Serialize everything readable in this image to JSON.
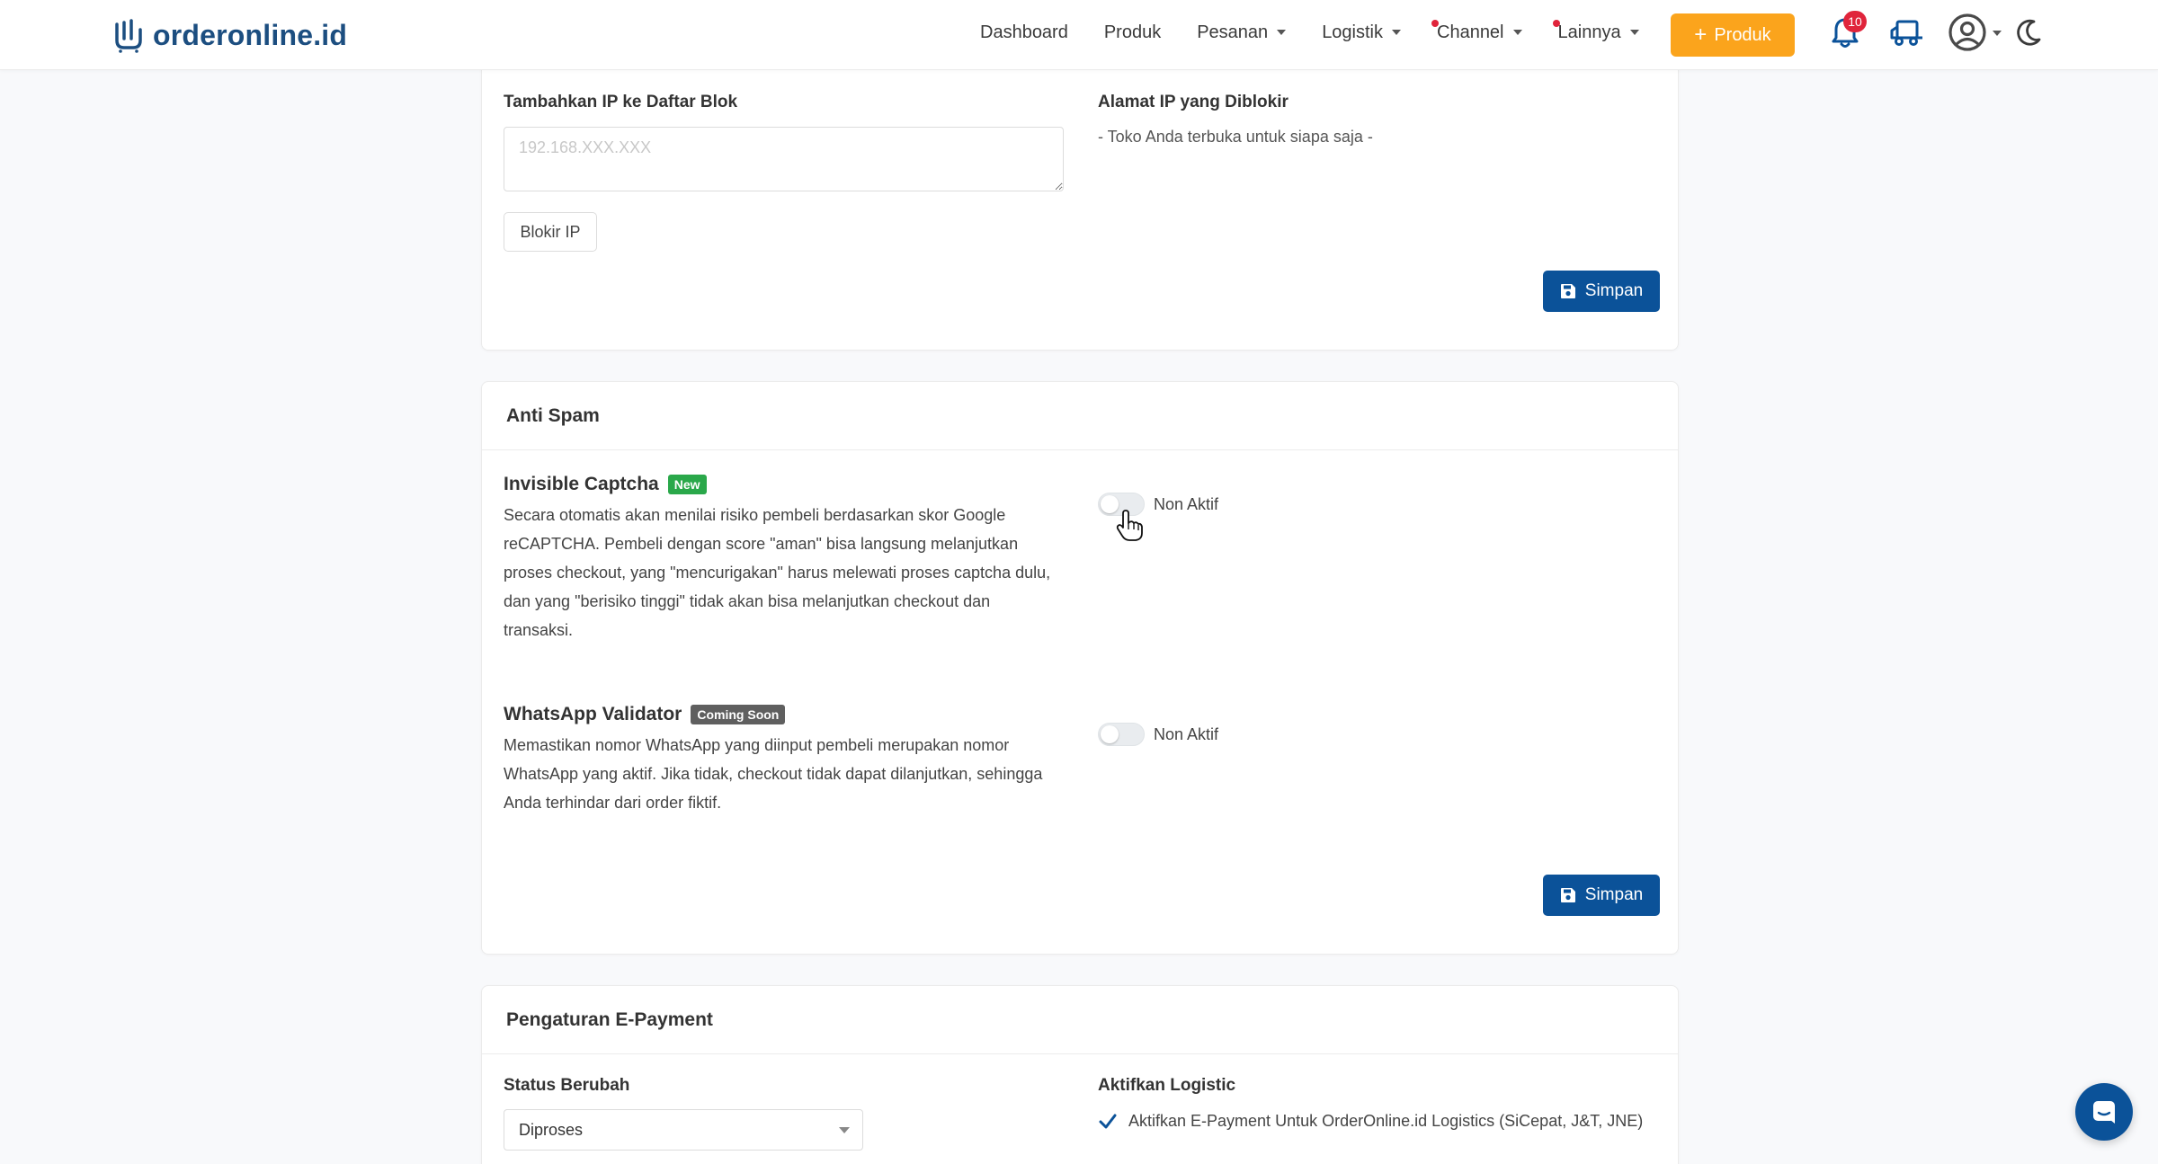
{
  "brand": {
    "name": "orderonline.id"
  },
  "nav": {
    "items": [
      {
        "label": "Dashboard",
        "has_dropdown": false,
        "has_dot": false
      },
      {
        "label": "Produk",
        "has_dropdown": false,
        "has_dot": false
      },
      {
        "label": "Pesanan",
        "has_dropdown": true,
        "has_dot": false
      },
      {
        "label": "Logistik",
        "has_dropdown": true,
        "has_dot": false
      },
      {
        "label": "Channel",
        "has_dropdown": true,
        "has_dot": true
      },
      {
        "label": "Lainnya",
        "has_dropdown": true,
        "has_dot": true
      }
    ],
    "add_product_label": "Produk",
    "notification_count": "10",
    "icons": [
      "bell-icon",
      "truck-icon",
      "user-icon",
      "moon-icon"
    ]
  },
  "ip_block": {
    "add_label": "Tambahkan IP ke Daftar Blok",
    "placeholder": "192.168.XXX.XXX",
    "block_button": "Blokir IP",
    "blocked_label": "Alamat IP yang Diblokir",
    "blocked_empty": "- Toko Anda terbuka untuk siapa saja -",
    "save_button": "Simpan"
  },
  "anti_spam": {
    "title": "Anti Spam",
    "captcha": {
      "title": "Invisible Captcha",
      "tag": "New",
      "description": "Secara otomatis akan menilai risiko pembeli berdasarkan skor Google reCAPTCHA. Pembeli dengan score \"aman\" bisa langsung melanjutkan proses checkout, yang \"mencurigakan\" harus melewati proses captcha dulu, dan yang \"berisiko tinggi\" tidak akan bisa melanjutkan checkout dan transaksi.",
      "status": "Non Aktif"
    },
    "whatsapp": {
      "title": "WhatsApp Validator",
      "tag": "Coming Soon",
      "description": "Memastikan nomor WhatsApp yang diinput pembeli merupakan nomor WhatsApp yang aktif. Jika tidak, checkout tidak dapat dilanjutkan, sehingga Anda terhindar dari order fiktif.",
      "status": "Non Aktif"
    },
    "save_button": "Simpan"
  },
  "epayment": {
    "title": "Pengaturan E-Payment",
    "status_label": "Status Berubah",
    "status_value": "Diproses",
    "logistic_label": "Aktifkan Logistic",
    "logistic_checkbox": "Aktifkan E-Payment Untuk OrderOnline.id Logistics (SiCepat, J&T, JNE)"
  },
  "colors": {
    "brand": "#1c4e80",
    "primary": "#0b5299",
    "accent_orange": "#fba41c",
    "badge_red": "#e0243b",
    "tag_new": "#2aa84a",
    "tag_soon": "#5f5f5f"
  }
}
